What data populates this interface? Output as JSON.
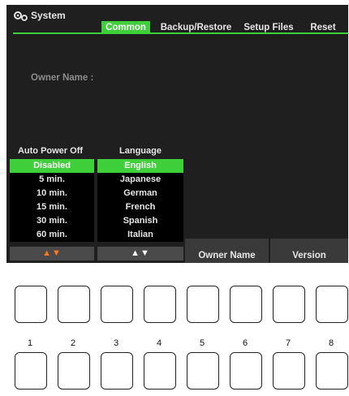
{
  "header": {
    "title": "System",
    "icon": "gears-icon"
  },
  "tabs": [
    {
      "label": "Common",
      "active": true
    },
    {
      "label": "Backup/Restore",
      "active": false
    },
    {
      "label": "Setup Files",
      "active": false
    },
    {
      "label": "Reset",
      "active": false
    }
  ],
  "owner_name_label": "Owner Name :",
  "auto_power_off": {
    "header": "Auto Power Off",
    "options": [
      "Disabled",
      "5 min.",
      "10 min.",
      "15 min.",
      "30 min.",
      "60 min."
    ],
    "selected": "Disabled",
    "arrows": "▲▼"
  },
  "language": {
    "header": "Language",
    "options": [
      "English",
      "Japanese",
      "German",
      "French",
      "Spanish",
      "Italian"
    ],
    "selected": "English",
    "arrows": "▲▼"
  },
  "buttons": {
    "owner_name": "Owner Name",
    "version": "Version"
  },
  "hardware_button_numbers": [
    "1",
    "2",
    "3",
    "4",
    "5",
    "6",
    "7",
    "8"
  ],
  "colors": {
    "accent": "#3fcf3a",
    "screen_bg": "#1f1f1f",
    "arrow_orange": "#ff7a1a"
  }
}
